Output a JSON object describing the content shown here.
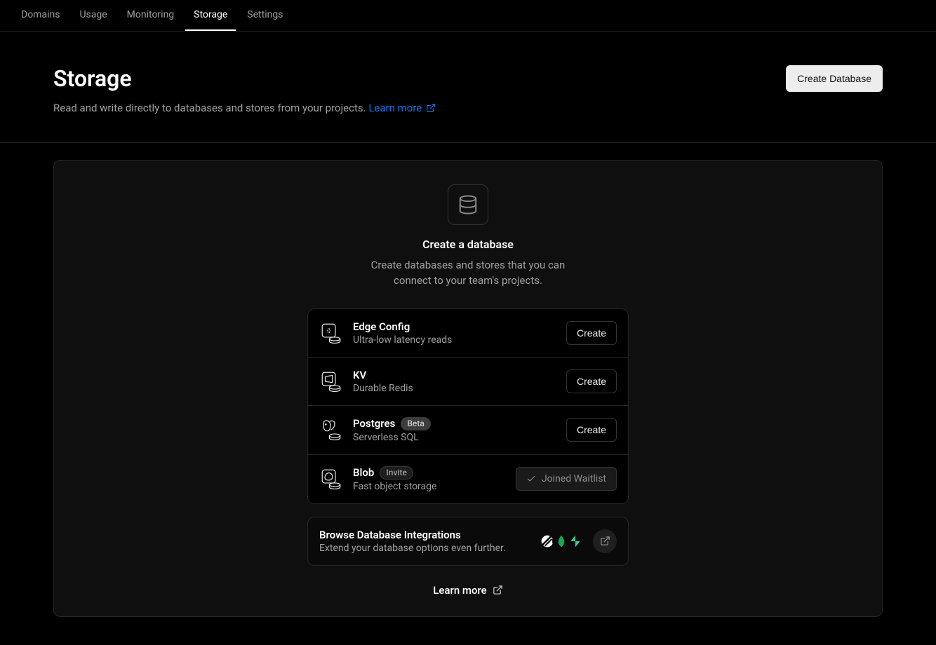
{
  "nav": {
    "tabs": [
      {
        "label": "Domains",
        "active": false
      },
      {
        "label": "Usage",
        "active": false
      },
      {
        "label": "Monitoring",
        "active": false
      },
      {
        "label": "Storage",
        "active": true
      },
      {
        "label": "Settings",
        "active": false
      }
    ]
  },
  "header": {
    "title": "Storage",
    "description": "Read and write directly to databases and stores from your projects.",
    "learn_more_label": "Learn more",
    "create_button": "Create Database"
  },
  "panel": {
    "heading": "Create a database",
    "subheading": "Create databases and stores that you can connect to your team's projects.",
    "options": [
      {
        "title": "Edge Config",
        "description": "Ultra-low latency reads",
        "badge": null,
        "action_label": "Create",
        "action_kind": "create"
      },
      {
        "title": "KV",
        "description": "Durable Redis",
        "badge": null,
        "action_label": "Create",
        "action_kind": "create"
      },
      {
        "title": "Postgres",
        "description": "Serverless SQL",
        "badge": "Beta",
        "badge_style": "solid",
        "action_label": "Create",
        "action_kind": "create"
      },
      {
        "title": "Blob",
        "description": "Fast object storage",
        "badge": "Invite",
        "badge_style": "outline",
        "action_label": "Joined Waitlist",
        "action_kind": "waitlist"
      }
    ],
    "integrations": {
      "title": "Browse Database Integrations",
      "description": "Extend your database options even further.",
      "logos": [
        "planetscale",
        "mongodb",
        "supabase"
      ]
    },
    "footer_learn_more": "Learn more"
  },
  "colors": {
    "accent_link": "#0b76ef",
    "mongo_green": "#13aa52",
    "supabase_green": "#3ecf8e"
  }
}
